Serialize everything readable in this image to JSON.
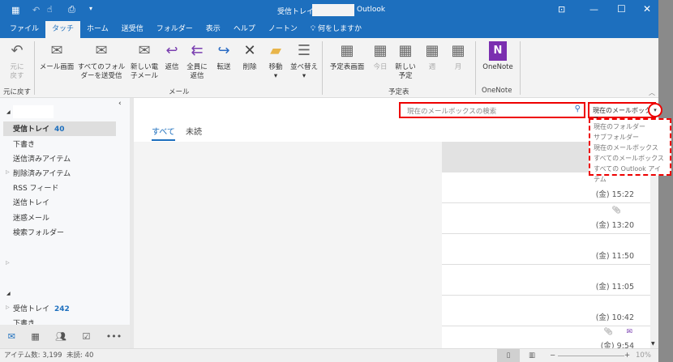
{
  "title": {
    "folder": "受信トレイ",
    "app": "Outlook"
  },
  "tabs": [
    "ファイル",
    "タッチ",
    "ホーム",
    "送受信",
    "フォルダー",
    "表示",
    "ヘルプ",
    "ノートン",
    "何をしますか"
  ],
  "ribbon": {
    "undo": {
      "label1": "元に",
      "label2": "戻す",
      "group": "元に戻す"
    },
    "mail": [
      "メール画面",
      "すべてのフォルダーを送受信",
      "新しい電子メール",
      "返信",
      "全員に返信",
      "転送",
      "削除",
      "移動",
      "並べ替え"
    ],
    "mail_group": "メール",
    "calendar": [
      "予定表画面",
      "今日",
      "新しい予定",
      "週",
      "月"
    ],
    "calendar_group": "予定表",
    "onenote": "OneNote",
    "onenote_group": "OneNote"
  },
  "search": {
    "placeholder": "現在のメールボックスの検索",
    "scope": "現在のメールボックス",
    "options": [
      "現在のフォルダー",
      "サブフォルダー",
      "現在のメールボックス",
      "すべてのメールボックス",
      "すべての Outlook アイテム"
    ]
  },
  "filters": [
    "すべて",
    "未読"
  ],
  "folders": [
    {
      "name": "受信トレイ",
      "count": "40"
    },
    {
      "name": "下書き"
    },
    {
      "name": "送信済みアイテム"
    },
    {
      "name": "削除済みアイテム"
    },
    {
      "name": "RSS フィード"
    },
    {
      "name": "送信トレイ"
    },
    {
      "name": "迷惑メール"
    },
    {
      "name": "検索フォルダー"
    }
  ],
  "folders2": [
    {
      "name": "受信トレイ",
      "count": "242"
    },
    {
      "name": "下書き"
    }
  ],
  "messages": [
    "(金) 15:22",
    "(金) 13:20",
    "(金) 11:50",
    "(金) 11:05",
    "(金) 10:42",
    "(金) 9:54"
  ],
  "status": {
    "items": "アイテム数: 3,199",
    "unread": "未読: 40",
    "zoom": "10%"
  },
  "colors": {
    "accent": "#1d6fbe",
    "highlight": "#e00000"
  }
}
